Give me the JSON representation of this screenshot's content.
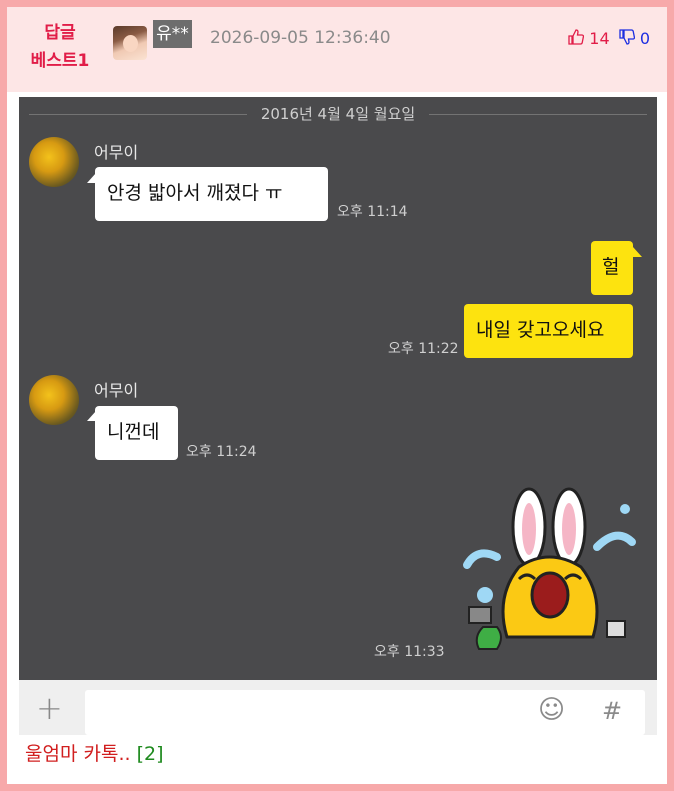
{
  "post": {
    "badge_line1": "답글",
    "badge_line2": "베스트1",
    "author": "유**",
    "date": "2026-09-05 12:36:40",
    "upvotes": "14",
    "downvotes": "0",
    "title": "울엄마 카톡..",
    "comment_count": "[2]"
  },
  "chat": {
    "date_divider": "2016년 4월 4일 월요일",
    "messages": [
      {
        "sender": "어무이",
        "text": "안경 밟아서  깨졌다 ㅠ",
        "time": "오후 11:14"
      },
      {
        "text": "헐"
      },
      {
        "text": "내일 갖고오세요",
        "time": "오후 11:22"
      },
      {
        "sender": "어무이",
        "text": "니껀데",
        "time": "오후 11:24"
      },
      {
        "sticker": "crying-rabbit-sticker",
        "time": "오후 11:33"
      }
    ],
    "input_bar": {
      "plus_icon": "+",
      "emoji_icon": "☺",
      "hash_icon": "#"
    }
  },
  "colors": {
    "frame_border": "#f7a9aa",
    "header_bg": "#fde6e6",
    "badge": "#e11d48",
    "chat_bg": "#4a4a4c",
    "my_bubble": "#fde30f",
    "caption_title": "#d11f1f",
    "caption_count": "#1e8a1e"
  }
}
